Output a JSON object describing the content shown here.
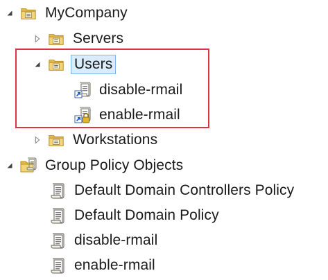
{
  "tree": {
    "root": {
      "label": "MyCompany",
      "icon": "ou-folder-icon",
      "expanded": true,
      "children": [
        {
          "label": "Servers",
          "icon": "ou-folder-icon",
          "expanded": false
        },
        {
          "label": "Users",
          "icon": "ou-folder-icon",
          "expanded": true,
          "selected": true,
          "children": [
            {
              "label": "disable-rmail",
              "icon": "gpo-link-icon"
            },
            {
              "label": "enable-rmail",
              "icon": "gpo-link-enforced-icon"
            }
          ]
        },
        {
          "label": "Workstations",
          "icon": "ou-folder-icon",
          "expanded": false
        }
      ]
    },
    "gpo_container": {
      "label": "Group Policy Objects",
      "icon": "gpo-container-icon",
      "expanded": true,
      "children": [
        {
          "label": "Default Domain Controllers Policy",
          "icon": "gpo-scroll-icon"
        },
        {
          "label": "Default Domain Policy",
          "icon": "gpo-scroll-icon"
        },
        {
          "label": "disable-rmail",
          "icon": "gpo-scroll-icon"
        },
        {
          "label": "enable-rmail",
          "icon": "gpo-scroll-icon"
        }
      ]
    }
  },
  "colors": {
    "highlight_border": "#e0323c",
    "selection_bg": "#d9ecfb",
    "selection_border": "#7eb4ea",
    "folder_yellow": "#e9c45a",
    "text": "#1a1a1a"
  }
}
